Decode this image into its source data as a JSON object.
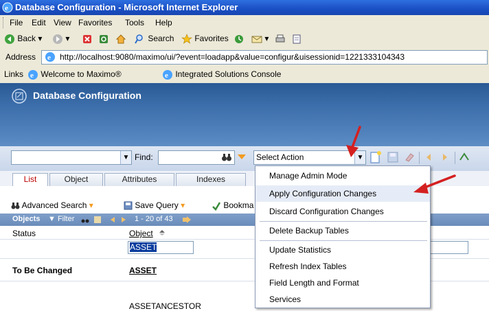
{
  "window": {
    "title": "Database Configuration - Microsoft Internet Explorer"
  },
  "menubar": {
    "items": [
      "File",
      "Edit",
      "View",
      "Favorites",
      "Tools",
      "Help"
    ]
  },
  "toolbar": {
    "back": "Back",
    "search": "Search",
    "favorites": "Favorites"
  },
  "address": {
    "label": "Address",
    "url": "http://localhost:9080/maximo/ui/?event=loadapp&value=configur&uisessionid=1221333104343"
  },
  "links": {
    "label": "Links",
    "items": [
      "Welcome to Maximo®",
      "Integrated Solutions Console"
    ]
  },
  "app": {
    "title": "Database Configuration",
    "find_label": "Find:",
    "select_action": "Select Action",
    "tabs": [
      "List",
      "Object",
      "Attributes",
      "Indexes"
    ],
    "subbar": {
      "advanced_search": "Advanced Search",
      "save_query": "Save Query",
      "bookmarks": "Bookma"
    },
    "objects_bar": {
      "title": "Objects",
      "filter": "Filter",
      "range": "1 - 20 of 43"
    },
    "grid": {
      "col_status": "Status",
      "col_object": "Object",
      "filter_object_value": "ASSET",
      "rows": [
        {
          "status": "To Be Changed",
          "object": "ASSET"
        }
      ],
      "partial_next_row": "ASSETANCESTOR"
    }
  },
  "action_menu": {
    "items": [
      "Manage Admin Mode",
      "Apply Configuration Changes",
      "Discard Configuration Changes",
      "Delete Backup Tables",
      "Update Statistics",
      "Refresh Index Tables",
      "Field Length and Format",
      "Services"
    ]
  },
  "colors": {
    "ie_title": "#1a4fc4",
    "maximo_header": "#3c6eab",
    "highlight": "#0a3d9e",
    "annotation_arrow": "#d42020"
  }
}
